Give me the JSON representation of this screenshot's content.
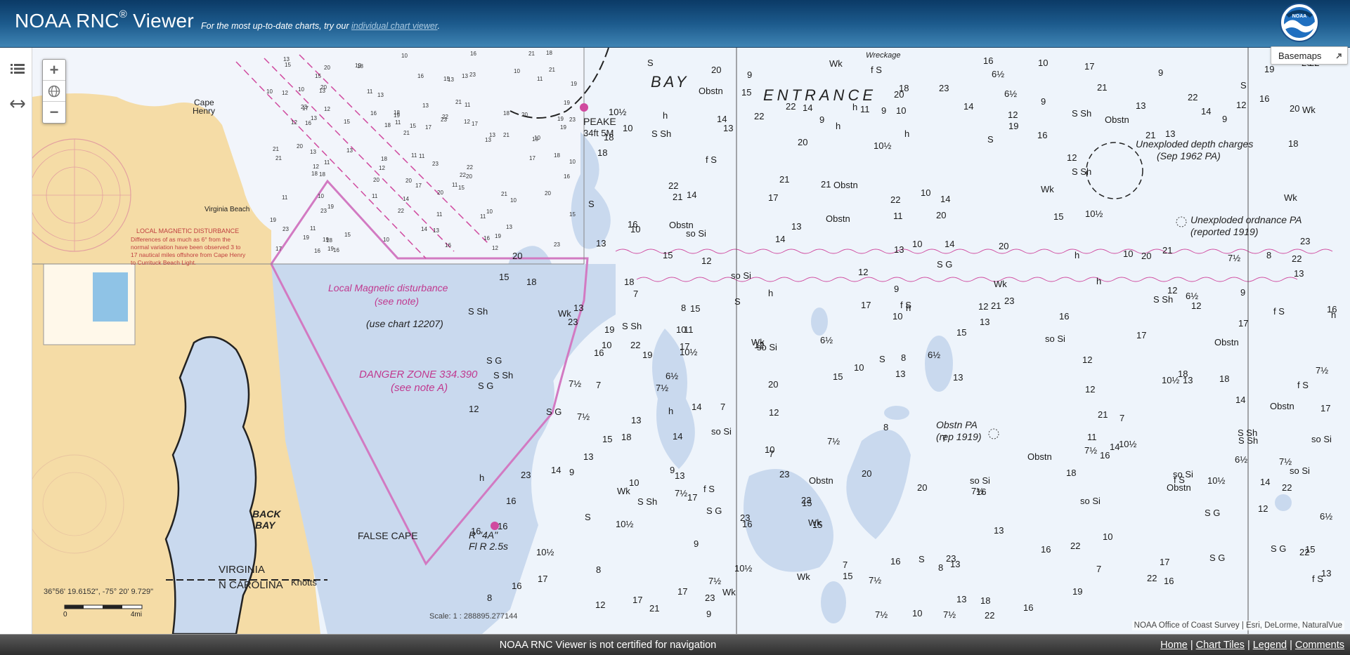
{
  "header": {
    "app_title": "NOAA RNC",
    "app_title_sup": "®",
    "app_title_suffix": " Viewer",
    "tagline_prefix": "For the most up-to-date charts, try our ",
    "tagline_link": "individual chart viewer",
    "tagline_suffix": ".",
    "logo_text": "NOAA"
  },
  "left_rail": {
    "items": [
      {
        "icon": "list-icon"
      },
      {
        "icon": "resize-horizontal-icon"
      }
    ]
  },
  "map_controls": {
    "zoom_in": "+",
    "zoom_out": "−",
    "basemaps_label": "Basemaps"
  },
  "chart_labels": {
    "bay": "BAY",
    "entrance": "ENTRANCE",
    "peake": "PEAKE",
    "peake_sub": "34ft 5M",
    "local_magnetic_1": "Local Magnetic disturbance",
    "local_magnetic_2": "(see note)",
    "use_chart": "(use chart 12207)",
    "danger_zone_1": "DANGER ZONE 334.390",
    "danger_zone_2": "(see note A)",
    "false_cape": "FALSE CAPE",
    "back_bay_1": "BACK",
    "back_bay_2": "BAY",
    "virginia": "VIRGINIA",
    "n_carolina": "N CAROLINA",
    "knotts": "Knotts",
    "cape_henry_1": "Cape",
    "cape_henry_2": "Henry",
    "virginia_beach": "Virginia Beach",
    "unexploded_depth_1": "Unexploded depth charges",
    "unexploded_depth_2": "(Sep 1962 PA)",
    "unexploded_ordnance_1": "Unexploded ordnance PA",
    "unexploded_ordnance_2": "(reported 1919)",
    "obstn_pa_1": "Obstn PA",
    "obstn_pa_2": "(rep 1919)",
    "wreckage": "Wreckage",
    "buoy_4a_1": "R \"4A\"",
    "buoy_4a_2": "Fl R 2.5s",
    "local_mag_dist_caps": "LOCAL MAGNETIC DISTURBANCE",
    "local_mag_dist_text_1": "Differences of as much as 6° from the",
    "local_mag_dist_text_2": "normal variation have been observed 3 to",
    "local_mag_dist_text_3": "17 nautical miles offshore from Cape Henry",
    "local_mag_dist_text_4": "to Currituck Beach Light."
  },
  "soundings": [
    "10",
    "11",
    "12",
    "13",
    "14",
    "15",
    "16",
    "17",
    "18",
    "19",
    "20",
    "21",
    "22",
    "23",
    "9",
    "8",
    "7",
    "10½",
    "6½",
    "7½",
    "S",
    "S Sh",
    "Wk",
    "Obstn",
    "S G",
    "f S",
    "h",
    "so Si",
    "13",
    "16"
  ],
  "coord_readout": "36°56' 19.6152\", -75° 20' 9.729\"",
  "scale_bar": {
    "left_label": "0",
    "right_label": "4mi"
  },
  "scale_text": "Scale: 1 : 288895.277144",
  "attribution": "NOAA Office of Coast Survey | Esri, DeLorme, NaturalVue",
  "footer": {
    "notice": "NOAA RNC Viewer is not certified for navigation",
    "links": [
      "Home",
      "Chart Tiles",
      "Legend",
      "Comments"
    ]
  },
  "colors": {
    "header_dark": "#0b3a66",
    "header_light": "#3f84b4",
    "water_shallow": "#c9d9ee",
    "water_deep": "#eef4fb",
    "land": "#f5dca6",
    "magenta": "#c0398f",
    "footer": "#3a3a3a"
  }
}
